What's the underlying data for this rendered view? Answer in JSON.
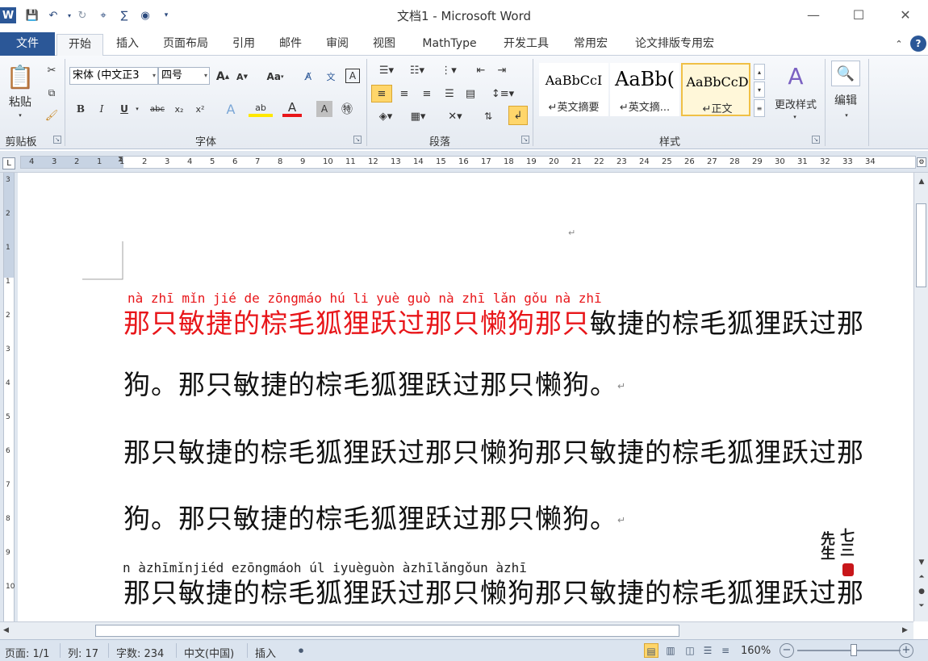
{
  "window": {
    "title": "文档1 - Microsoft Word",
    "app_icon": "W",
    "controls": {
      "minimize": "—",
      "maximize": "☐",
      "close": "✕"
    }
  },
  "quick_access": [
    "save-icon",
    "undo-icon",
    "redo-icon",
    "format-painter-icon",
    "mathtype-icon",
    "insert-equation-icon",
    "customize-icon"
  ],
  "tabs": [
    {
      "label": "文件"
    },
    {
      "label": "开始"
    },
    {
      "label": "插入"
    },
    {
      "label": "页面布局"
    },
    {
      "label": "引用"
    },
    {
      "label": "邮件"
    },
    {
      "label": "审阅"
    },
    {
      "label": "视图"
    },
    {
      "label": "MathType"
    },
    {
      "label": "开发工具"
    },
    {
      "label": "常用宏"
    },
    {
      "label": "论文排版专用宏"
    }
  ],
  "ribbon": {
    "clipboard": {
      "paste_label": "粘贴",
      "group_label": "剪贴板"
    },
    "font": {
      "font_name": "宋体 (中文正3",
      "font_size": "四号",
      "grow_label": "A",
      "shrink_label": "A",
      "change_case_label": "Aa",
      "bold": "B",
      "italic": "I",
      "underline": "U",
      "strike": "abc",
      "subscript": "x₂",
      "superscript": "x²",
      "group_label": "字体"
    },
    "paragraph": {
      "group_label": "段落"
    },
    "styles": {
      "items": [
        {
          "sample": "AaBbCcI",
          "name": "↵英文摘要"
        },
        {
          "sample": "AaBb(",
          "name": "↵英文摘..."
        },
        {
          "sample": "AaBbCcD",
          "name": "↵正文"
        }
      ],
      "change_styles_label": "更改样式",
      "group_label": "样式"
    },
    "editing": {
      "label": "编辑"
    }
  },
  "ruler_numbers": [
    "4",
    "3",
    "2",
    "1",
    "1",
    "2",
    "3",
    "4",
    "5",
    "6",
    "7",
    "8",
    "9",
    "10",
    "11",
    "12",
    "13",
    "14",
    "15",
    "16",
    "17",
    "18",
    "19",
    "20",
    "21",
    "22",
    "23",
    "24",
    "25",
    "26",
    "27",
    "28",
    "29",
    "30",
    "31",
    "32",
    "33",
    "34"
  ],
  "vruler_numbers": [
    "3",
    "2",
    "1",
    "1",
    "2",
    "3",
    "4",
    "5",
    "6",
    "7",
    "8",
    "9",
    "10"
  ],
  "document": {
    "pinyin_line1": "nà zhī mǐn jié de zōngmáo hú li yuè guò nà zhī lǎn gǒu nà zhī",
    "line1_red": "那只敏捷的棕毛狐狸跃过那只懒狗那只",
    "line1_black": "敏捷的棕毛狐狸跃过那",
    "line2": "狗。那只敏捷的棕毛狐狸跃过那只懒狗。",
    "line3": "那只敏捷的棕毛狐狸跃过那只懒狗那只敏捷的棕毛狐狸跃过那",
    "line4": "狗。那只敏捷的棕毛狐狸跃过那只懒狗。",
    "pinyin_line5": "n àzhīmǐnjiéd ezōngmáoh úl iyuèguòn àzhīlǎngǒun àzhī",
    "line5": "那只敏捷的棕毛狐狸跃过那只懒狗那只敏捷的棕毛狐狸跃过那",
    "para_mark": "↵",
    "stamp": {
      "col1": "先生",
      "col2": "七三"
    }
  },
  "statusbar": {
    "page": "页面: 1/1",
    "column": "列: 17",
    "word_count": "字数: 234",
    "language": "中文(中国)",
    "mode": "插入",
    "zoom": "160%",
    "zoom_level_percent": 160
  },
  "colors": {
    "accent": "#2b5797",
    "red_text": "#e8161a"
  }
}
